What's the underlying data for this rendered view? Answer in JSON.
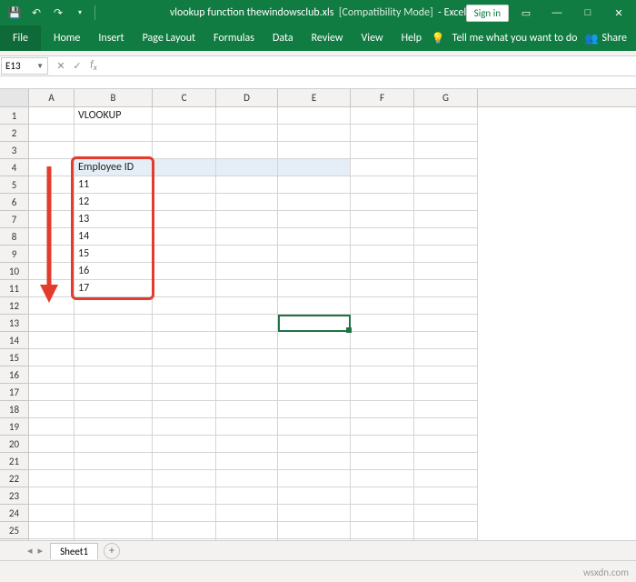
{
  "title": {
    "filename": "vlookup function thewindowsclub.xls",
    "mode": "[Compatibility Mode]",
    "app": "Excel",
    "signin": "Sign in"
  },
  "ribbon": {
    "file": "File",
    "tabs": [
      "Home",
      "Insert",
      "Page Layout",
      "Formulas",
      "Data",
      "Review",
      "View",
      "Help"
    ],
    "tellme": "Tell me what you want to do",
    "share": "Share"
  },
  "namebox": "E13",
  "columns": [
    "A",
    "B",
    "C",
    "D",
    "E",
    "F",
    "G"
  ],
  "cells": {
    "B1": "VLOOKUP",
    "B4": "Employee ID",
    "B5": "11",
    "B6": "12",
    "B7": "13",
    "B8": "14",
    "B9": "15",
    "B10": "16",
    "B11": "17"
  },
  "active_cell": "E13",
  "sheet": {
    "name": "Sheet1"
  },
  "watermark": "wsxdn.com"
}
